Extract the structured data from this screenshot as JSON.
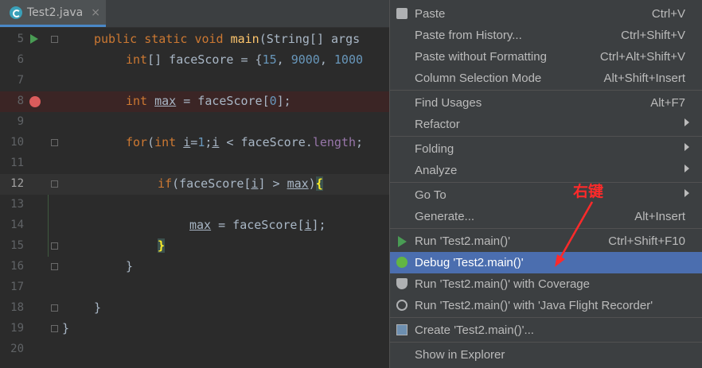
{
  "tab": {
    "filename": "Test2.java",
    "close": "×",
    "icon": "java-class-icon"
  },
  "editor": {
    "lines": [
      {
        "n": "5"
      },
      {
        "n": "6"
      },
      {
        "n": "7"
      },
      {
        "n": "8"
      },
      {
        "n": "9"
      },
      {
        "n": "10"
      },
      {
        "n": "11"
      },
      {
        "n": "12"
      },
      {
        "n": "13"
      },
      {
        "n": "14"
      },
      {
        "n": "15"
      },
      {
        "n": "16"
      },
      {
        "n": "17"
      },
      {
        "n": "18"
      },
      {
        "n": "19"
      },
      {
        "n": "20"
      }
    ],
    "code": {
      "l5": [
        "public",
        " ",
        "static",
        " ",
        "void",
        " ",
        "main",
        "(String[] args"
      ],
      "l6": [
        "int",
        "[] faceScore = {",
        "15",
        ", ",
        "9000",
        ", ",
        "1000"
      ],
      "l8": [
        "int",
        " ",
        "max",
        " = faceScore[",
        "0",
        "];"
      ],
      "l10": [
        "for",
        "(",
        "int",
        " ",
        "i",
        "=",
        "1",
        ";",
        "i",
        " < faceScore.",
        "length",
        ";"
      ],
      "l12": [
        "if",
        "(faceScore[",
        "i",
        "] > ",
        "max",
        ")",
        "{"
      ],
      "l14": [
        "max",
        " = faceScore[",
        "i",
        "];"
      ],
      "l15": [
        "}"
      ],
      "l16": [
        "}"
      ],
      "l18": [
        "}"
      ],
      "l19": [
        "}"
      ]
    }
  },
  "menu": {
    "items": [
      {
        "label": "Paste",
        "shortcut": "Ctrl+V"
      },
      {
        "label": "Paste from History...",
        "shortcut": "Ctrl+Shift+V"
      },
      {
        "label": "Paste without Formatting",
        "shortcut": "Ctrl+Alt+Shift+V"
      },
      {
        "label": "Column Selection Mode",
        "shortcut": "Alt+Shift+Insert"
      },
      {
        "label": "Find Usages",
        "shortcut": "Alt+F7"
      },
      {
        "label": "Refactor",
        "shortcut": ""
      },
      {
        "label": "Folding",
        "shortcut": ""
      },
      {
        "label": "Analyze",
        "shortcut": ""
      },
      {
        "label": "Go To",
        "shortcut": ""
      },
      {
        "label": "Generate...",
        "shortcut": "Alt+Insert"
      },
      {
        "label": "Run 'Test2.main()'",
        "shortcut": "Ctrl+Shift+F10"
      },
      {
        "label": "Debug 'Test2.main()'",
        "shortcut": ""
      },
      {
        "label": "Run 'Test2.main()' with Coverage",
        "shortcut": ""
      },
      {
        "label": "Run 'Test2.main()' with 'Java Flight Recorder'",
        "shortcut": ""
      },
      {
        "label": "Create 'Test2.main()'...",
        "shortcut": ""
      },
      {
        "label": "Show in Explorer",
        "shortcut": ""
      }
    ]
  },
  "annotation": {
    "text": "右键",
    "color": "#ff2a2a"
  }
}
